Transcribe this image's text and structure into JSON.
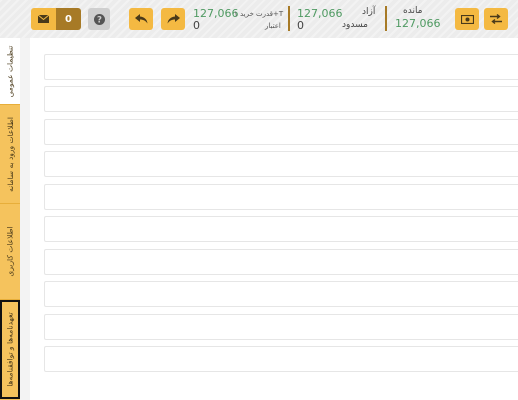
{
  "header": {
    "mail_count": "0",
    "credit_1p1": {
      "label": "قدرت خرید ۱+T",
      "value": "127,066",
      "sub_label": "اعتبار",
      "sub_value": "0"
    },
    "free": {
      "label": "آزاد",
      "value": "127,066"
    },
    "blocked": {
      "label": "مسدود",
      "value": "0"
    },
    "balance": {
      "label": "مانده",
      "value": "127,066"
    },
    "icons": {
      "mail": "envelope-icon",
      "help": "question-icon",
      "undo": "reply-icon",
      "redo": "forward-icon",
      "cash": "money-icon",
      "transfer": "exchange-icon"
    }
  },
  "sidebar": {
    "tabs": [
      {
        "label": "تنظیمات عمومی"
      },
      {
        "label": "اطلاعات ورود به سامانه"
      },
      {
        "label": "اطلاعات کاربری"
      },
      {
        "label": "تعهدنامه‌ها و توافقنامه‌ها"
      }
    ]
  },
  "form": {
    "row_count": 10
  },
  "colors": {
    "accent": "#f4b942",
    "accent_dark": "#a77a26",
    "tab_bg": "#f5c35d",
    "positive": "#4f9a62"
  }
}
